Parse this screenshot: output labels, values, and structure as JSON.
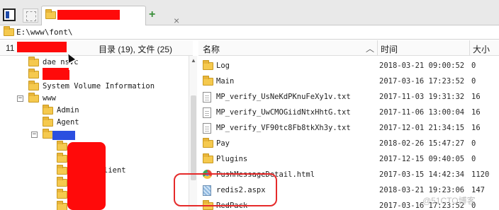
{
  "path": "E:\\www\\font\\",
  "left_header": {
    "count_prefix": "11",
    "summary": "目录 (19), 文件 (25)"
  },
  "columns": {
    "name": "名称",
    "time": "时间",
    "size": "大小",
    "sort_icon": "chevron-up-icon"
  },
  "tree": [
    {
      "label": "dae  nsvc",
      "icon": "folder-icon"
    },
    {
      "label": "",
      "icon": "folder-icon"
    },
    {
      "label": "System Volume Information",
      "icon": "folder-icon"
    },
    {
      "label": "www",
      "icon": "folder-icon",
      "expander": "−"
    },
    {
      "label": "Admin",
      "icon": "folder-icon"
    },
    {
      "label": "Agent",
      "icon": "folder-icon"
    },
    {
      "label": "",
      "icon": "folder-icon",
      "expander": "−"
    },
    {
      "label": "",
      "icon": "folder-icon"
    },
    {
      "label": "",
      "icon": "folder-icon"
    },
    {
      "label": "lient",
      "icon": "folder-icon"
    },
    {
      "label": "",
      "icon": "folder-icon"
    },
    {
      "label": "",
      "icon": "folder-icon"
    }
  ],
  "files": [
    {
      "name": "Log",
      "time": "2018-03-21 09:00:52",
      "size": "0",
      "icon": "folder-icon"
    },
    {
      "name": "Main",
      "time": "2017-03-16 17:23:52",
      "size": "0",
      "icon": "folder-icon"
    },
    {
      "name": "MP_verify_UsNeKdPKnuFeXy1v.txt",
      "time": "2017-11-03 19:31:32",
      "size": "16",
      "icon": "file-icon"
    },
    {
      "name": "MP_verify_UwCMOGiidNtxHhtG.txt",
      "time": "2017-11-06 13:00:04",
      "size": "16",
      "icon": "file-icon"
    },
    {
      "name": "MP_verify_VF90tc8Fb8tkXh3y.txt",
      "time": "2017-12-01 21:34:15",
      "size": "16",
      "icon": "file-icon"
    },
    {
      "name": "Pay",
      "time": "2018-02-26 15:47:27",
      "size": "0",
      "icon": "folder-icon"
    },
    {
      "name": "Plugins",
      "time": "2017-12-15 09:40:05",
      "size": "0",
      "icon": "folder-icon"
    },
    {
      "name": "PushMessageDetail.html",
      "time": "2017-03-15 14:42:34",
      "size": "1120",
      "icon": "html-icon"
    },
    {
      "name": "redis2.aspx",
      "time": "2018-03-21 19:23:06",
      "size": "147",
      "icon": "aspx-icon"
    },
    {
      "name": "RedPack",
      "time": "2017-03-16 17:23:52",
      "size": "0",
      "icon": "folder-icon"
    }
  ],
  "tab": {
    "close_icon": "close-icon",
    "add_label": "+"
  },
  "watermark": "@51CTO博客",
  "colors": {
    "redaction": "#ff0a0a",
    "highlight": "#e52a2a",
    "folder": "#f5c94e"
  }
}
